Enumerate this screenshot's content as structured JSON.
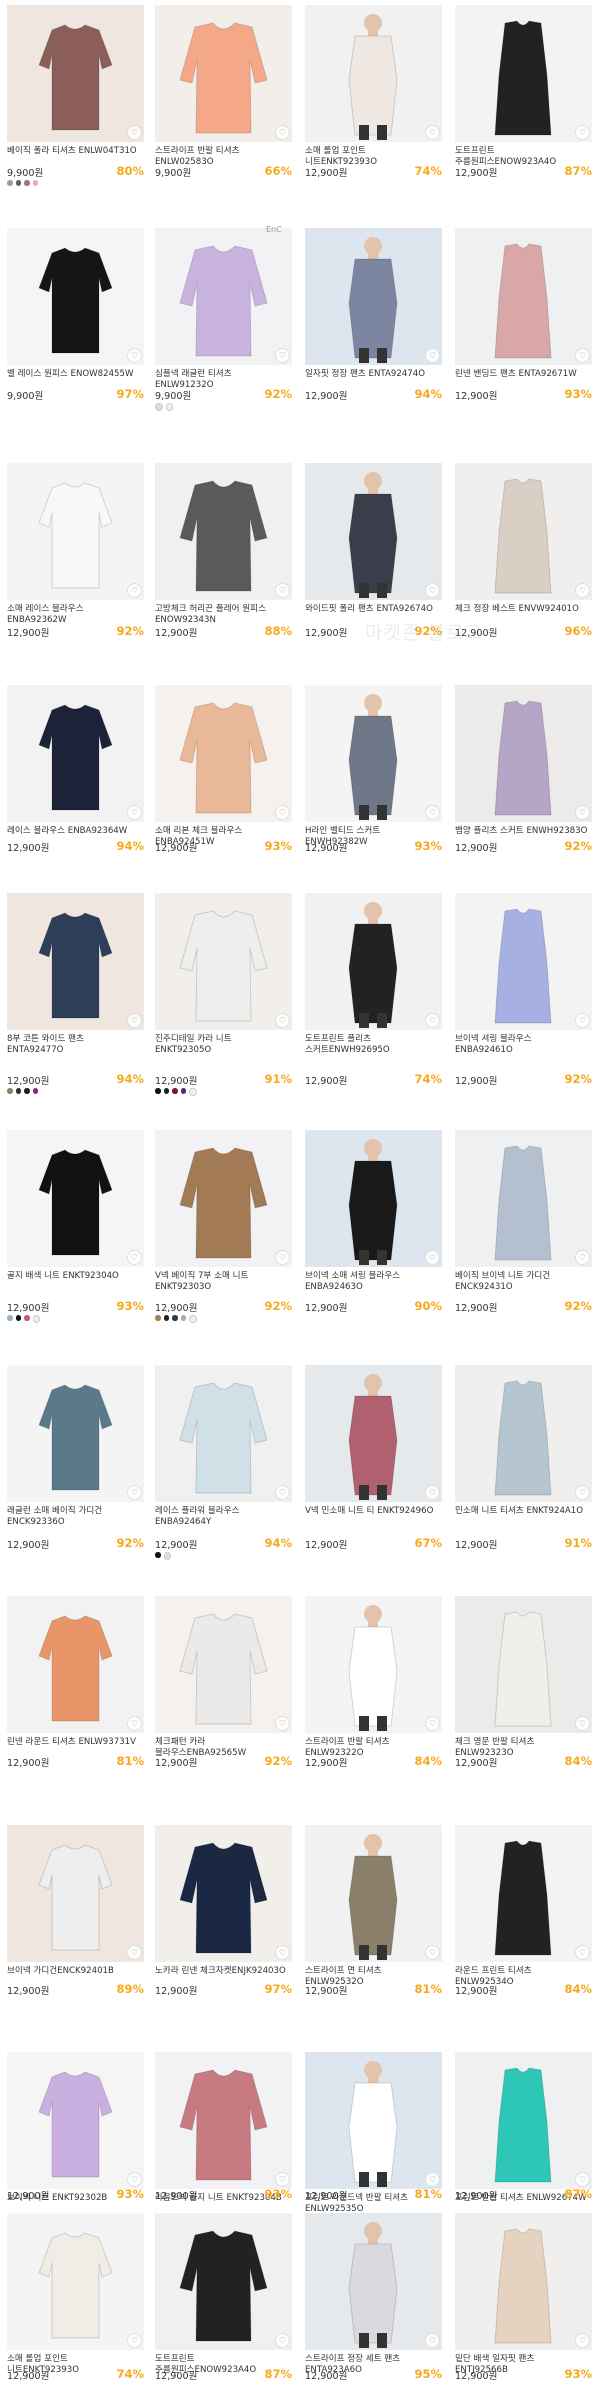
{
  "watermark": "마켓존 블로그",
  "brandmark": "EnC",
  "colors": {
    "discount": "#f7a81b",
    "price": "#333333"
  },
  "products": [
    {
      "title": "베이직 폴라 티셔츠 ENLW04T31O",
      "price": "9,900원",
      "discount": "80%",
      "swatches": [
        "#9aa0a8",
        "#5a5f6b",
        "#a56c86",
        "#d8b0b8"
      ]
    },
    {
      "title": "스트라이프 반팔 티셔츠\nENLW02583O",
      "price": "9,900원",
      "discount": "66%",
      "swatches": []
    },
    {
      "title": "소매 롤업 포인트\n니트ENKT92393O",
      "price": "12,900원",
      "discount": "74%",
      "swatches": []
    },
    {
      "title": "도트프린트\n주름원피스ENOW923A4O",
      "price": "12,900원",
      "discount": "87%",
      "swatches": []
    },
    {
      "title": "벨 레이스 원피스 ENOW82455W",
      "price": "9,900원",
      "discount": "97%",
      "swatches": []
    },
    {
      "title": "심플넥 래글런 티셔츠\nENLW91232O",
      "price": "9,900원",
      "discount": "92%",
      "swatches": [
        "#ddd",
        "#eee"
      ]
    },
    {
      "title": "일자핏 정장 팬츠 ENTA92474O",
      "price": "12,900원",
      "discount": "94%",
      "swatches": []
    },
    {
      "title": "린넨 밴딩드 팬츠 ENTA92671W",
      "price": "12,900원",
      "discount": "93%",
      "swatches": []
    },
    {
      "title": "소매 레이스 블라우스\nENBA92362W",
      "price": "12,900원",
      "discount": "92%",
      "swatches": []
    },
    {
      "title": "고방체크 허리끈 플레어 원피스\nENOW92343N",
      "price": "12,900원",
      "discount": "88%",
      "swatches": []
    },
    {
      "title": "와이드핏 폴리 팬츠 ENTA92674O",
      "price": "12,900원",
      "discount": "92%",
      "swatches": []
    },
    {
      "title": "체크 정장 베스트 ENVW92401O",
      "price": "12,900원",
      "discount": "96%",
      "swatches": []
    },
    {
      "title": "레이스 블라우스 ENBA92364W",
      "price": "12,900원",
      "discount": "94%",
      "swatches": []
    },
    {
      "title": "소매 리본 체크 블라우스\nENBA92451W",
      "price": "12,900원",
      "discount": "93%",
      "swatches": []
    },
    {
      "title": "H라인 벨티드 스커트\nENWH92382W",
      "price": "12,900원",
      "discount": "93%",
      "swatches": []
    },
    {
      "title": "뱀양 플리츠 스커트 ENWH92383O",
      "price": "12,900원",
      "discount": "92%",
      "swatches": []
    },
    {
      "title": "8부 코튼 와이드 팬츠\nENTA92477O",
      "price": "12,900원",
      "discount": "94%",
      "swatches": [
        "#7a8a6a",
        "#2b2b3a",
        "#222",
        "#8a2a6a"
      ]
    },
    {
      "title": "진주디테일 카라 니트\nENKT92305O",
      "price": "12,900원",
      "discount": "91%",
      "swatches": [
        "#111",
        "#222",
        "#7a1a2a",
        "#5a2a7a",
        "#eee"
      ]
    },
    {
      "title": "도트프린트 플리츠\n스커트ENWH92695O",
      "price": "12,900원",
      "discount": "74%",
      "swatches": []
    },
    {
      "title": "브이넥 셔링 블라우스\nENBA92461O",
      "price": "12,900원",
      "discount": "92%",
      "swatches": []
    },
    {
      "title": "골지 배색 니트 ENKT92304O",
      "price": "12,900원",
      "discount": "93%",
      "swatches": [
        "#9ab0d0",
        "#111",
        "#c45a6a",
        "#eee"
      ]
    },
    {
      "title": "V넥 베이직 7부 소매 니트\nENKT92303O",
      "price": "12,900원",
      "discount": "92%",
      "swatches": [
        "#a0805a",
        "#222",
        "#2a3a5a",
        "#aaa",
        "#eee"
      ]
    },
    {
      "title": "브이넥 소매 셔링 블라우스\nENBA92463O",
      "price": "12,900원",
      "discount": "90%",
      "swatches": []
    },
    {
      "title": "베이직 브이넥 니트 가디건\nENCK92431O",
      "price": "12,900원",
      "discount": "92%",
      "swatches": []
    },
    {
      "title": "래글런 소매 베이직 가디건\nENCK92336O",
      "price": "12,900원",
      "discount": "92%",
      "swatches": []
    },
    {
      "title": "레이스 플라워 블라우스\nENBA92464Y",
      "price": "12,900원",
      "discount": "94%",
      "swatches": [
        "#111",
        "#ddd"
      ]
    },
    {
      "title": "V넥 민소매 니트 티 ENKT92496O",
      "price": "12,900원",
      "discount": "67%",
      "swatches": []
    },
    {
      "title": "민소매 니트 티셔츠 ENKT924A1O",
      "price": "12,900원",
      "discount": "91%",
      "swatches": []
    },
    {
      "title": "린넨 라운드 티셔츠 ENLW93731V",
      "price": "12,900원",
      "discount": "81%",
      "swatches": []
    },
    {
      "title": "체크패턴 카라\n블라우스ENBA92565W",
      "price": "12,900원",
      "discount": "92%",
      "swatches": []
    },
    {
      "title": "스트라이프 반팔 티셔츠\nENLW92322O",
      "price": "12,900원",
      "discount": "84%",
      "swatches": []
    },
    {
      "title": "체크 영문 반팔 티셔츠\nENLW92323O",
      "price": "12,900원",
      "discount": "84%",
      "swatches": []
    },
    {
      "title": "브이넥 가디건ENCK92401B",
      "price": "12,900원",
      "discount": "89%",
      "swatches": []
    },
    {
      "title": "노카라 린넨 체크자켓ENJK92403O",
      "price": "12,900원",
      "discount": "97%",
      "swatches": []
    },
    {
      "title": "스트라이프 면 티셔츠\nENLW92532O",
      "price": "12,900원",
      "discount": "81%",
      "swatches": []
    },
    {
      "title": "라운드 프린트 티셔츠\nENLW92534O",
      "price": "12,900원",
      "discount": "84%",
      "swatches": []
    },
    {
      "title": "브이넥 니트 ENKT92302B",
      "price": "12,900원",
      "discount": "93%",
      "swatches": []
    },
    {
      "title": "라운드넥 골지 니트 ENKT92304B",
      "price": "12,900원",
      "discount": "93%",
      "swatches": []
    },
    {
      "title": "프린트 라운드넥 반팔 티셔츠\nENLW92535O",
      "price": "12,900원",
      "discount": "81%",
      "swatches": []
    },
    {
      "title": "프린트 반팔 티셔츠 ENLW92674W",
      "price": "12,900원",
      "discount": "87%",
      "swatches": []
    },
    {
      "title": "소매 롤업 포인트\n니트ENKT92393O",
      "price": "12,900원",
      "discount": "74%",
      "swatches": []
    },
    {
      "title": "도트프린트\n주름원피스ENOW923A4O",
      "price": "12,900원",
      "discount": "87%",
      "swatches": []
    },
    {
      "title": "스트라이프 정장 세트 팬츠\nENTA923A6O",
      "price": "12,900원",
      "discount": "95%",
      "swatches": []
    },
    {
      "title": "밑단 배색 일자핏 팬츠\nENTJ92566B",
      "price": "12,900원",
      "discount": "93%",
      "swatches": []
    }
  ]
}
